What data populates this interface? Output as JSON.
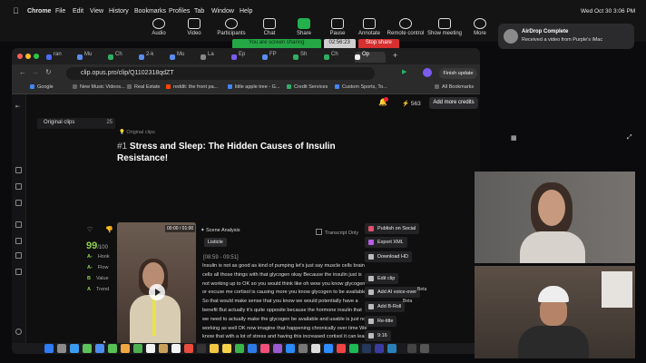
{
  "menubar": {
    "app": "Chrome",
    "items": [
      "File",
      "Edit",
      "View",
      "History",
      "Bookmarks",
      "Profiles",
      "Tab",
      "Window",
      "Help"
    ],
    "clock": "Wed Oct 30  3:06 PM"
  },
  "zoom": {
    "buttons": [
      "Audio",
      "Video",
      "Participants",
      "Chat",
      "Share",
      "Pause",
      "Annotate",
      "Remote control",
      "Show meeting",
      "More"
    ],
    "sharing_text": "You are screen sharing",
    "timer": "02:56:23",
    "stop_label": "Stop share"
  },
  "notification": {
    "title": "AirDrop Complete",
    "body": "Received a video from Purple's iMac"
  },
  "browser": {
    "tabs": [
      "ran",
      "Mu",
      "Ch",
      "2-k",
      "Mu",
      "La",
      "Ep",
      "FP",
      "Sh",
      "Ch",
      "Op"
    ],
    "url": "clip.opus.pro/clip/Q1102318qdZT",
    "finish_update": "Finish update",
    "bookmarks": [
      "Google",
      "New Music Videos...",
      "Real Estate",
      "reddit: the front pa...",
      "little apple tree - G...",
      "Credit Services",
      "Custom Sports, To..."
    ],
    "all_bookmarks": "All Bookmarks"
  },
  "opus": {
    "original_clips_label": "Original clips",
    "original_clips_count": "25",
    "credits": "563",
    "add_credits": "Add more credits",
    "breadcrumb": "Original clips",
    "clip_number": "#1",
    "clip_title": "Stress and Sleep: The Hidden Causes of Insulin Resistance!",
    "score": "99",
    "score_suffix": "/100",
    "score_rows": [
      {
        "grade": "A-",
        "label": "Hook"
      },
      {
        "grade": "A-",
        "label": "Flow"
      },
      {
        "grade": "B",
        "label": "Value"
      },
      {
        "grade": "A",
        "label": "Trend"
      }
    ],
    "video_duration": "00:00 / 01:00",
    "scene_analysis": "Scene Analysis",
    "listicle": "Listicle",
    "transcript_only": "Transcript Only",
    "timecode": "[08:59 - 09:51]",
    "transcript": "Insulin is not as good as kind of pumping let's just say muscle cells brain cells all those things with that glycogen okay Because the insulin just is not working up to OK so you would think like oh wow you know glycogen or excuse me cortisol is causing more you know glycogen to be available So that would make sense that you know we would potentially have a benefit But actually it's quite opposite because the hormone insulin that we need to actually make the glycogen be available and usable is just not working as well OK now imagine that happening chronically over time We know that with a lot of stress and having this increased cortisol it can lead to insulin resistance because we're going to have elevated blood sugars over a long period of time Again over time stress really can impact that",
    "actions": [
      "Publish on Social",
      "Export XML",
      "Download HD",
      "Edit clip",
      "Add AI voice-over",
      "Add B-Roll",
      "Re-title",
      "9:16"
    ],
    "beta_label": "Beta"
  },
  "colors": {
    "accent_green": "#8fd14f",
    "share_green": "#25a745",
    "stop_red": "#d63030"
  }
}
